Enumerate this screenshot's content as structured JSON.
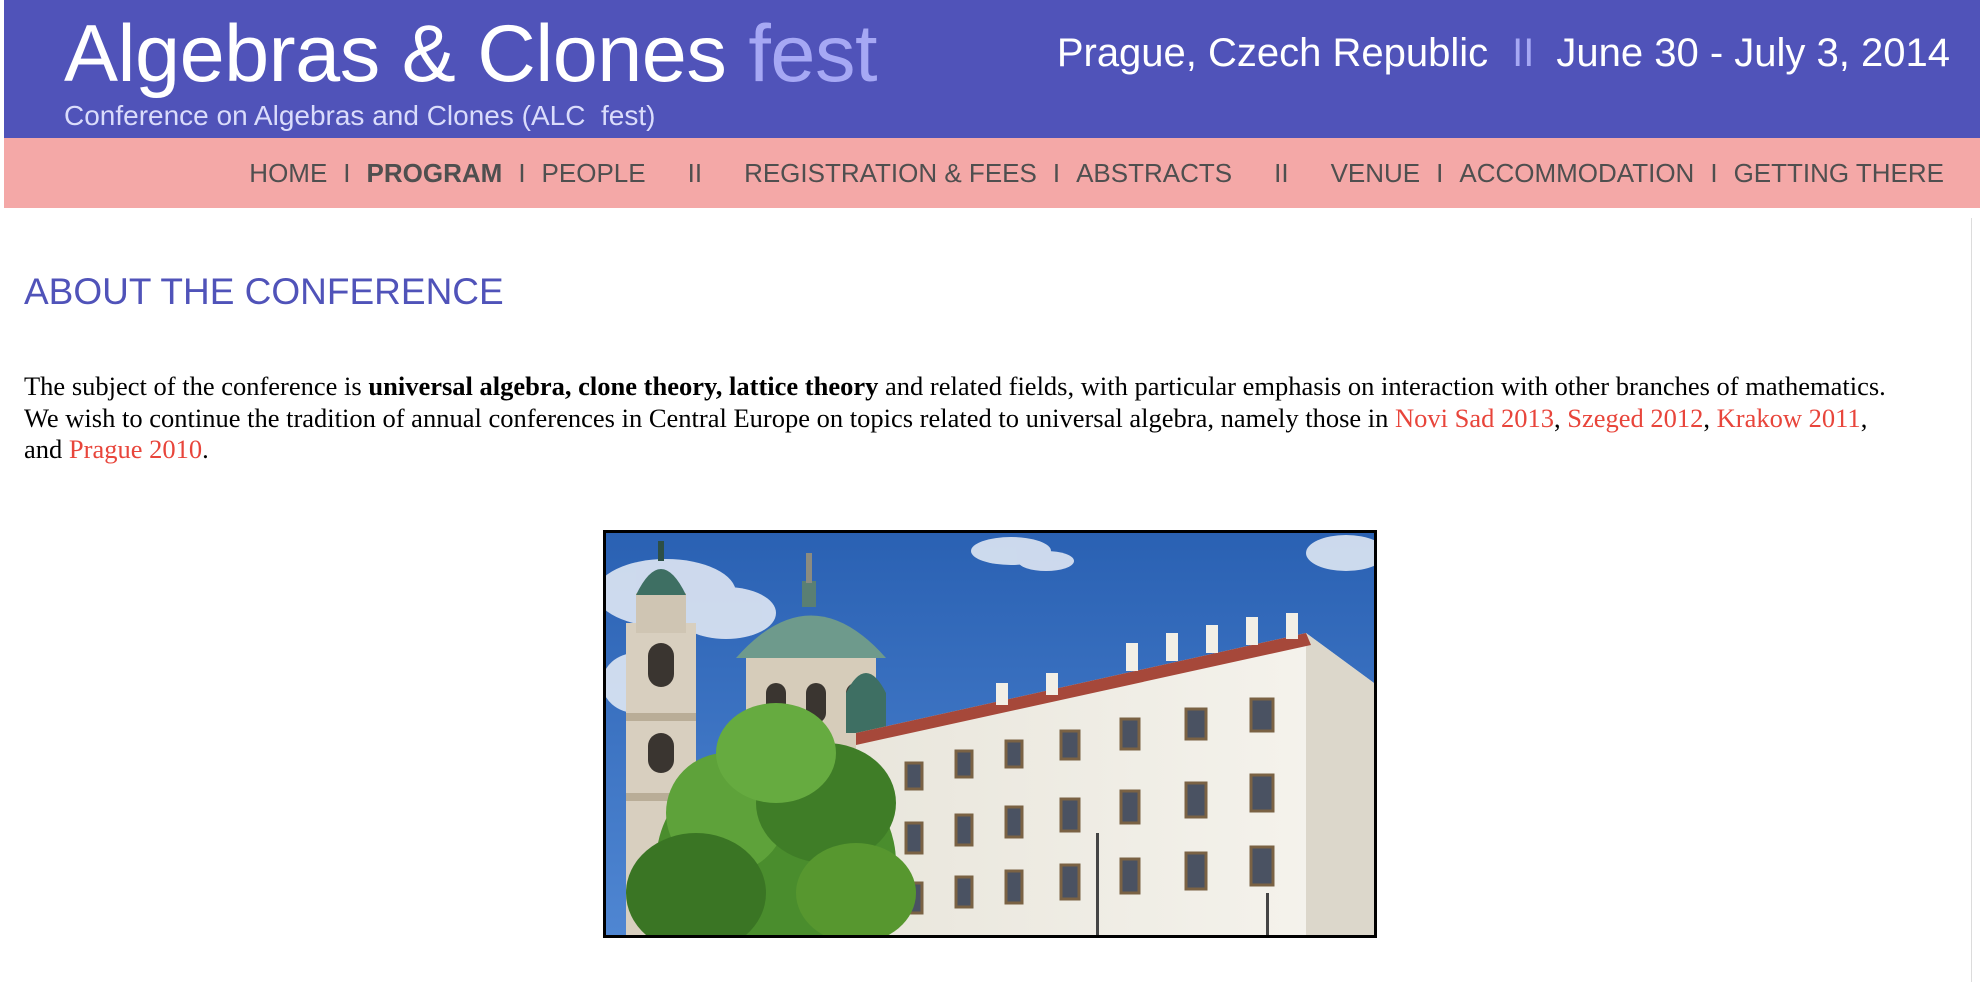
{
  "header": {
    "title_main": "Algebras & Clones",
    "title_accent": "fest",
    "subtitle": "Conference on Algebras and Clones (ALC  fest)",
    "location": "Prague, Czech Republic",
    "separator": "II",
    "dates": "June 30 - July 3, 2014",
    "colors": {
      "header_bg": "#5053b9",
      "nav_bg": "#f4a8a7",
      "accent": "#a6a8f4",
      "link": "#e8453b"
    }
  },
  "nav": {
    "home": "HOME",
    "program": "PROGRAM",
    "people": "PEOPLE",
    "registration": "REGISTRATION & FEES",
    "abstracts": "ABSTRACTS",
    "venue": "VENUE",
    "accommodation": "ACCOMMODATION",
    "getting_there": "GETTING THERE",
    "sep_single": "I",
    "sep_double": "II",
    "active_item": "PROGRAM"
  },
  "main": {
    "heading": "ABOUT THE CONFERENCE",
    "intro": {
      "t1": "The subject of the conference is ",
      "bold": "universal algebra, clone theory, lattice theory",
      "t2": " and related fields, with particular emphasis on interaction with other branches of mathematics. We wish to continue the tradition of annual conferences in Central Europe on topics related to universal algebra, namely those in ",
      "link1": "Novi Sad 2013",
      "c1": ", ",
      "link2": "Szeged 2012",
      "c2": ", ",
      "link3": "Krakow 2011",
      "c3": ", and ",
      "link4": "Prague 2010",
      "end": "."
    },
    "photo": {
      "subject": "prague-church-and-building-photo"
    }
  }
}
